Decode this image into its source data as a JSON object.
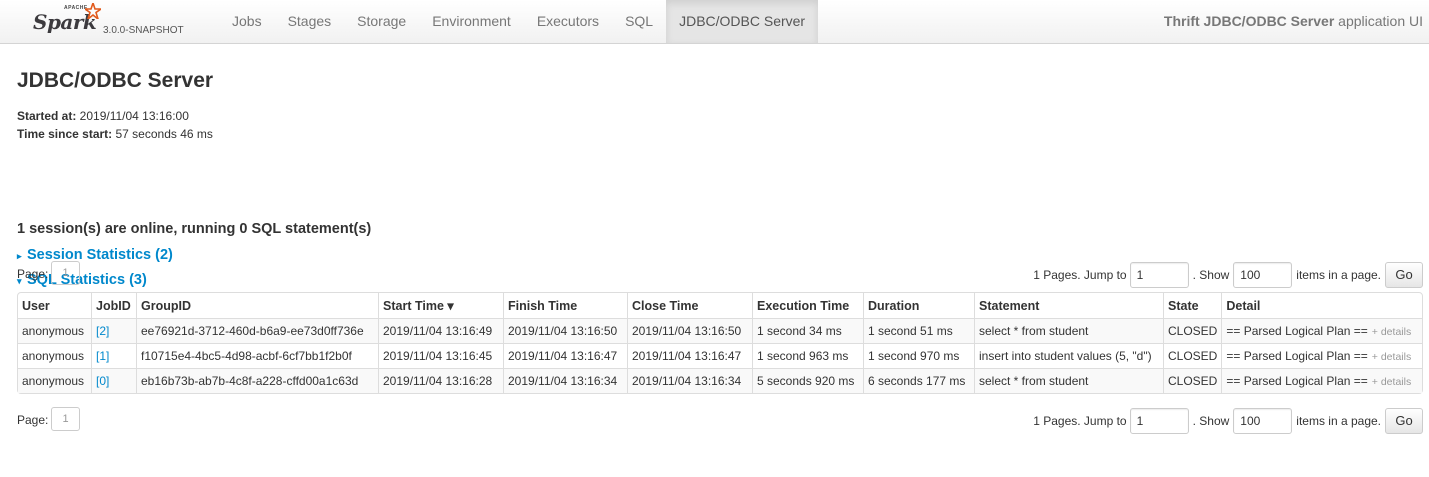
{
  "navbar": {
    "brand": {
      "apache": "APACHE",
      "name": "Spark",
      "version": "3.0.0-SNAPSHOT"
    },
    "tabs": [
      {
        "label": "Jobs"
      },
      {
        "label": "Stages"
      },
      {
        "label": "Storage"
      },
      {
        "label": "Environment"
      },
      {
        "label": "Executors"
      },
      {
        "label": "SQL"
      },
      {
        "label": "JDBC/ODBC Server",
        "active": true
      }
    ],
    "app_title_bold": "Thrift JDBC/ODBC Server",
    "app_title_rest": " application UI"
  },
  "page": {
    "title": "JDBC/ODBC Server",
    "started_label": "Started at:",
    "started_value": " 2019/11/04 13:16:00",
    "elapsed_label": "Time since start:",
    "elapsed_value": " 57 seconds 46 ms",
    "online_text": "1 session(s) are online, running 0 SQL statement(s)",
    "session_stats": "Session Statistics (2)",
    "sql_stats": "SQL Statistics (3)"
  },
  "pager": {
    "page_label": "Page:",
    "current_page": "1",
    "pages_text": "1 Pages. Jump to",
    "jump_value": "1",
    "show_label": ". Show",
    "show_value": "100",
    "items_label": "items in a page.",
    "go_label": "Go"
  },
  "table": {
    "headers": [
      "User",
      "JobID",
      "GroupID",
      "Start Time ▾",
      "Finish Time",
      "Close Time",
      "Execution Time",
      "Duration",
      "Statement",
      "State",
      "Detail"
    ],
    "details_link": "+ details",
    "rows": [
      {
        "user": "anonymous",
        "job": "[2]",
        "group": "ee76921d-3712-460d-b6a9-ee73d0ff736e",
        "start": "2019/11/04 13:16:49",
        "finish": "2019/11/04 13:16:50",
        "close": "2019/11/04 13:16:50",
        "exec": "1 second 34 ms",
        "duration": "1 second 51 ms",
        "statement": "select * from student",
        "state": "CLOSED",
        "detail": "== Parsed Logical Plan =="
      },
      {
        "user": "anonymous",
        "job": "[1]",
        "group": "f10715e4-4bc5-4d98-acbf-6cf7bb1f2b0f",
        "start": "2019/11/04 13:16:45",
        "finish": "2019/11/04 13:16:47",
        "close": "2019/11/04 13:16:47",
        "exec": "1 second 963 ms",
        "duration": "1 second 970 ms",
        "statement": "insert into student values (5, \"d\")",
        "state": "CLOSED",
        "detail": "== Parsed Logical Plan =="
      },
      {
        "user": "anonymous",
        "job": "[0]",
        "group": "eb16b73b-ab7b-4c8f-a228-cffd00a1c63d",
        "start": "2019/11/04 13:16:28",
        "finish": "2019/11/04 13:16:34",
        "close": "2019/11/04 13:16:34",
        "exec": "5 seconds 920 ms",
        "duration": "6 seconds 177 ms",
        "statement": "select * from student",
        "state": "CLOSED",
        "detail": "== Parsed Logical Plan =="
      }
    ]
  },
  "colors": {
    "link": "#0088cc",
    "brand_star": "#e25a1c"
  }
}
